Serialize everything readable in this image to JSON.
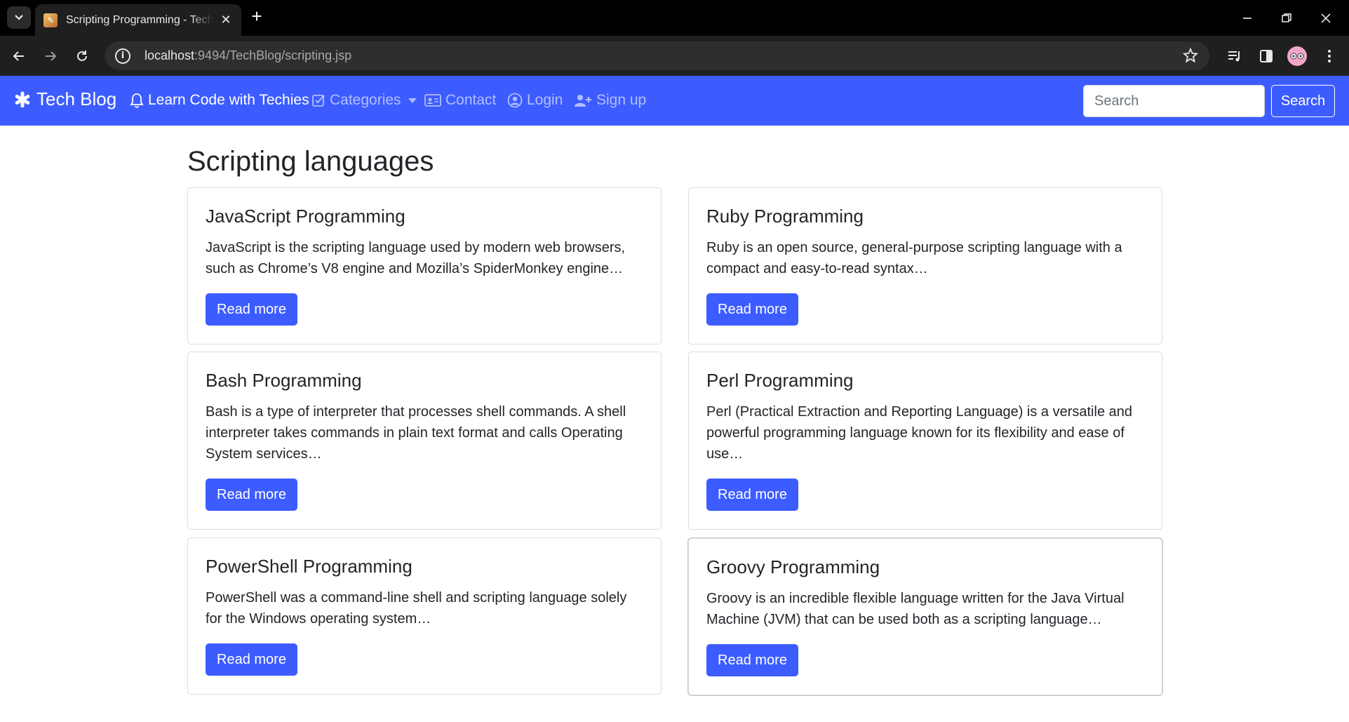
{
  "browser": {
    "tab_title": "Scripting Programming - TechBlog",
    "url_host": "localhost",
    "url_rest": ":9494/TechBlog/scripting.jsp"
  },
  "navbar": {
    "brand": "Tech Blog",
    "items": [
      {
        "label": "Learn Code with Techies",
        "icon": "bell-icon"
      },
      {
        "label": "Categories",
        "icon": "check-square-icon"
      },
      {
        "label": "Contact",
        "icon": "address-card-icon"
      },
      {
        "label": "Login",
        "icon": "user-circle-icon"
      },
      {
        "label": "Sign up",
        "icon": "user-plus-icon"
      }
    ],
    "search_placeholder": "Search",
    "search_button": "Search",
    "accent_color": "#3d5cff"
  },
  "page": {
    "title": "Scripting languages",
    "cards": [
      {
        "title": "JavaScript Programming",
        "text": "JavaScript is the scripting language used by modern web browsers, such as Chrome’s V8 engine and Mozilla’s SpiderMonkey engine…",
        "button": "Read more"
      },
      {
        "title": "Ruby Programming",
        "text": "Ruby is an open source, general-purpose scripting language with a compact and easy-to-read syntax…",
        "button": "Read more"
      },
      {
        "title": "Bash Programming",
        "text": "Bash is a type of interpreter that processes shell commands. A shell interpreter takes commands in plain text format and calls Operating System services…",
        "button": "Read more"
      },
      {
        "title": "Perl Programming",
        "text": "Perl (Practical Extraction and Reporting Language) is a versatile and powerful programming language known for its flexibility and ease of use…",
        "button": "Read more"
      },
      {
        "title": "PowerShell Programming",
        "text": "PowerShell was a command-line shell and scripting language solely for the Windows operating system…",
        "button": "Read more"
      },
      {
        "title": "Groovy Programming",
        "text": "Groovy is an incredible flexible language written for the Java Virtual Machine (JVM) that can be used both as a scripting language…",
        "button": "Read more"
      }
    ]
  }
}
